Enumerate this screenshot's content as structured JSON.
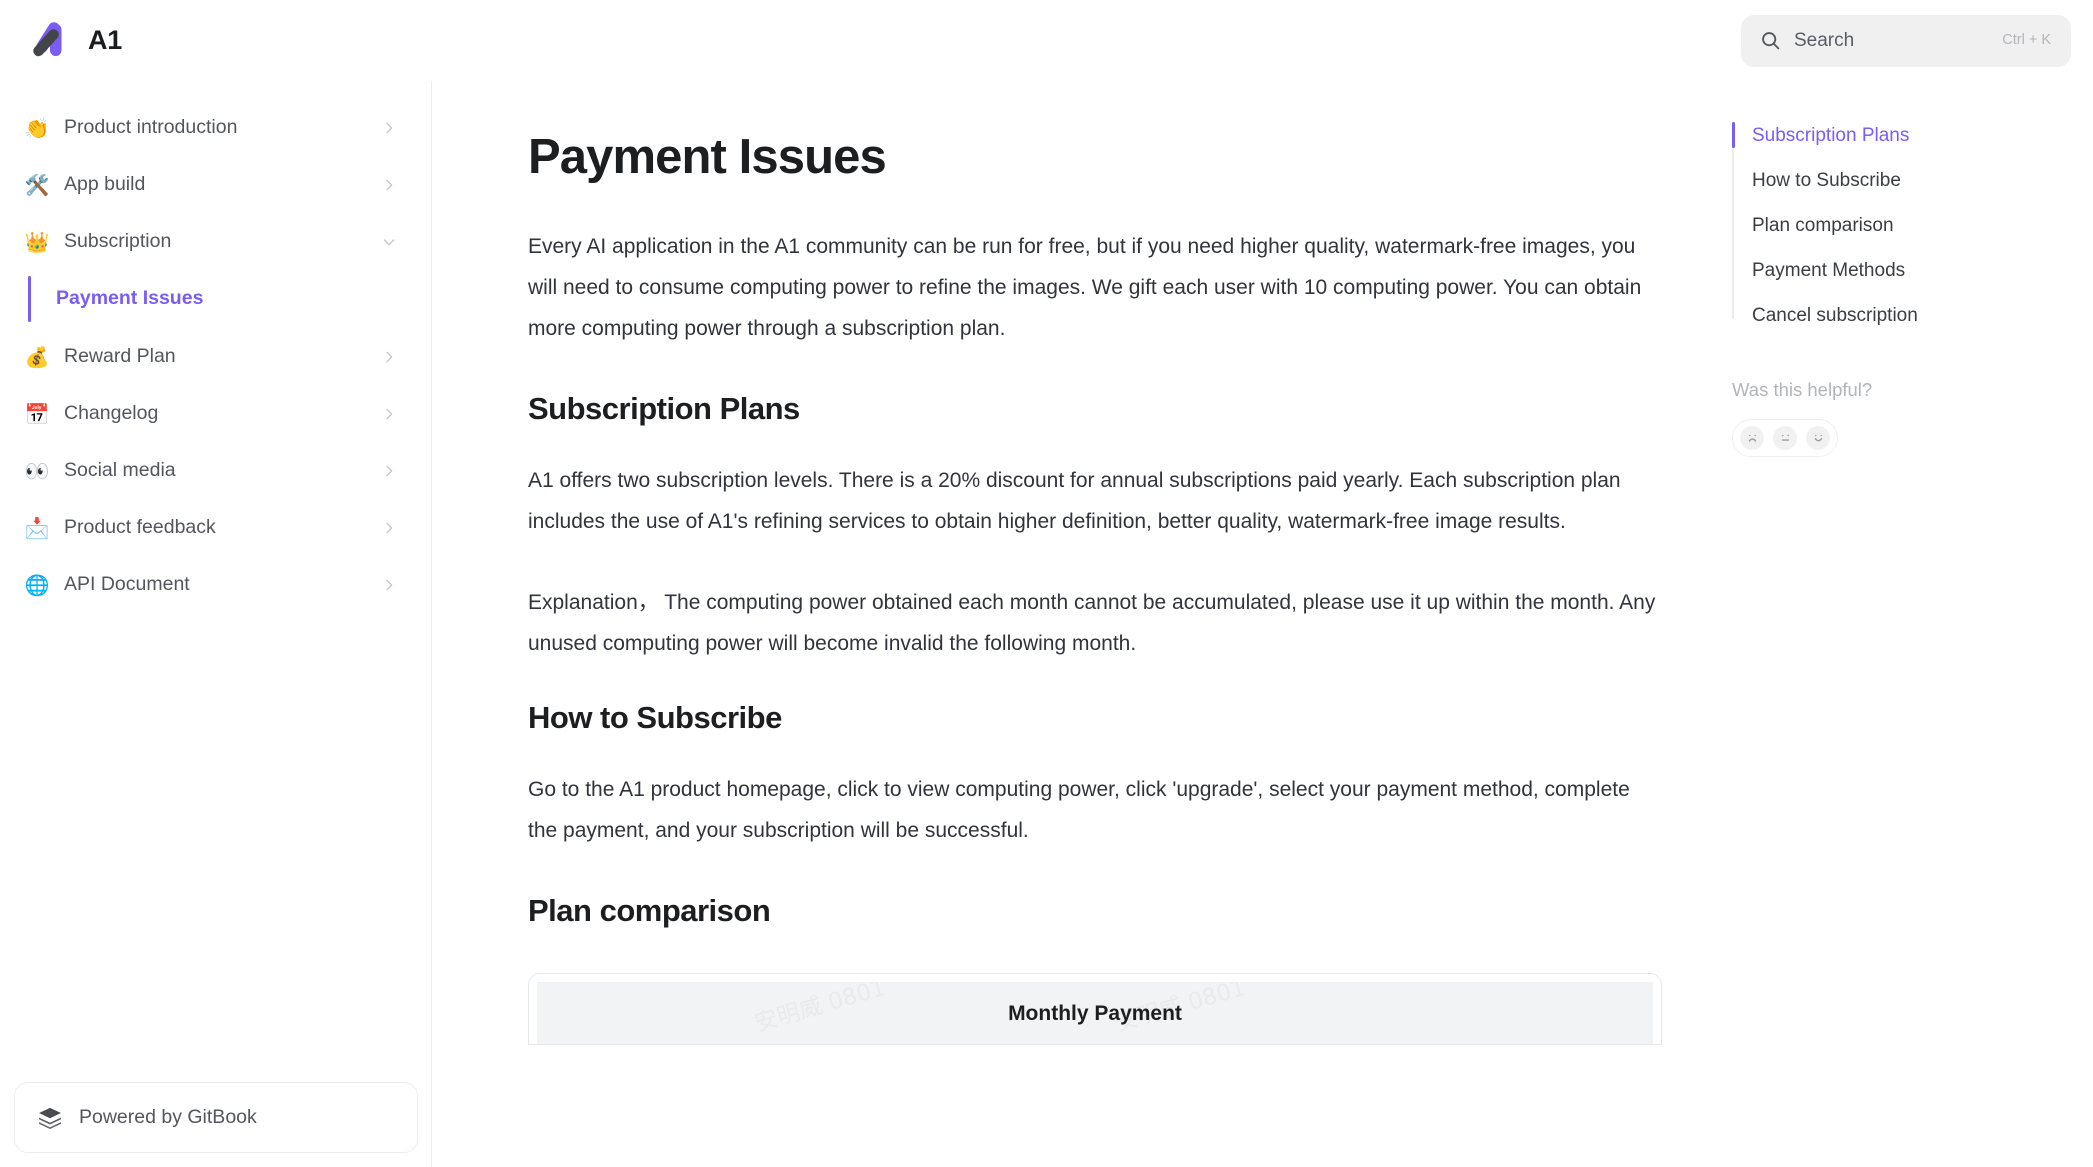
{
  "header": {
    "brand_title": "A1",
    "logo_icon": "a1-logo",
    "search": {
      "icon": "search-icon",
      "placeholder": "Search",
      "shortcut": "Ctrl + K",
      "value": ""
    }
  },
  "sidebar": {
    "items": [
      {
        "emoji": "👏",
        "icon_name": "clapping-hands-icon",
        "label": "Product introduction",
        "chevron": "chevron-right-icon",
        "expanded": false
      },
      {
        "emoji": "🛠️",
        "icon_name": "hammer-and-wrench-icon",
        "label": "App build",
        "chevron": "chevron-right-icon",
        "expanded": false
      },
      {
        "emoji": "👑",
        "icon_name": "crown-icon",
        "label": "Subscription",
        "chevron": "chevron-down-icon",
        "expanded": true
      },
      {
        "emoji": "💰",
        "icon_name": "money-bag-icon",
        "label": "Reward Plan",
        "chevron": "chevron-right-icon",
        "expanded": false
      },
      {
        "emoji": "📅",
        "icon_name": "calendar-icon",
        "label": "Changelog",
        "chevron": "chevron-right-icon",
        "expanded": false
      },
      {
        "emoji": "👀",
        "icon_name": "eyes-icon",
        "label": "Social media",
        "chevron": "chevron-right-icon",
        "expanded": false
      },
      {
        "emoji": "📩",
        "icon_name": "envelope-with-arrow-icon",
        "label": "Product feedback",
        "chevron": "chevron-right-icon",
        "expanded": false
      },
      {
        "emoji": "🌐",
        "icon_name": "globe-icon",
        "label": "API Document",
        "chevron": "chevron-right-icon",
        "expanded": false
      }
    ],
    "active_child": {
      "label": "Payment Issues",
      "parent": "Subscription"
    },
    "footer": {
      "icon": "gitbook-logo-icon",
      "label": "Powered by GitBook"
    }
  },
  "main": {
    "title": "Payment Issues",
    "intro": "Every AI application in the A1 community can be run for free, but if you need higher quality, watermark-free images, you will need to consume computing power to refine the images. We gift each user with 10 computing power. You can obtain more computing power through a subscription plan.",
    "sections": [
      {
        "heading": "Subscription Plans",
        "paragraphs": [
          "A1 offers two subscription levels. There is a 20% discount for annual subscriptions paid yearly. Each subscription plan includes the use of A1's refining services to obtain higher definition, better quality, watermark-free image results.",
          "Explanation，  The computing power obtained each month cannot be accumulated, please use it up within the month. Any unused computing power will become invalid the following month."
        ]
      },
      {
        "heading": "How to Subscribe",
        "paragraphs": [
          "Go to the A1 product homepage, click to view computing power, click 'upgrade', select your payment method, complete the payment, and your subscription will be successful."
        ]
      },
      {
        "heading": "Plan comparison",
        "paragraphs": []
      }
    ],
    "plan_table": {
      "header_label": "Monthly Payment"
    },
    "watermark": "安明威 0801"
  },
  "toc": {
    "items": [
      {
        "label": "Subscription Plans",
        "active": true
      },
      {
        "label": "How to Subscribe",
        "active": false
      },
      {
        "label": "Plan comparison",
        "active": false
      },
      {
        "label": "Payment Methods",
        "active": false
      },
      {
        "label": "Cancel subscription",
        "active": false
      }
    ],
    "feedback": {
      "label": "Was this helpful?",
      "options": [
        {
          "icon": "sad-face-icon",
          "value": "not-helpful"
        },
        {
          "icon": "neutral-face-icon",
          "value": "neutral"
        },
        {
          "icon": "happy-face-icon",
          "value": "helpful"
        }
      ]
    }
  },
  "colors": {
    "accent": "#7b5cf5",
    "text": "#31343a",
    "heading": "#1d1e20",
    "muted": "#b2b4b8",
    "border": "#ededee",
    "search_bg": "#f0f0f0",
    "table_head_bg": "#f2f3f5"
  }
}
